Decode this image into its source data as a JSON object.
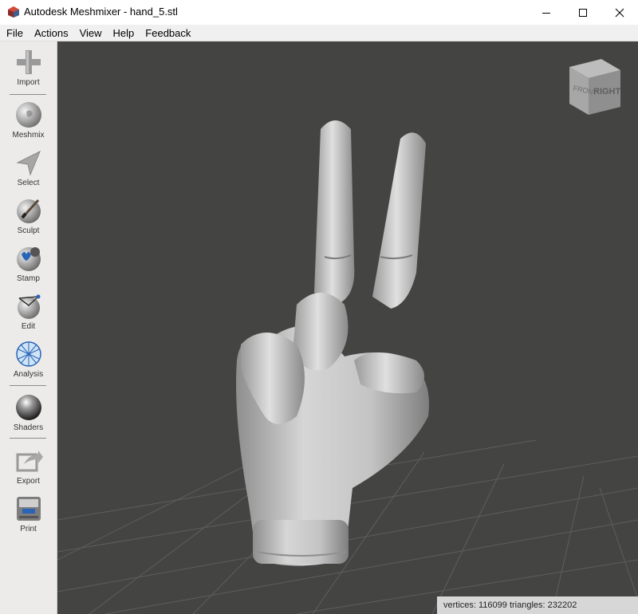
{
  "window": {
    "title": "Autodesk Meshmixer - hand_5.stl",
    "controls": [
      "minimize",
      "maximize",
      "close"
    ]
  },
  "menu": [
    "File",
    "Actions",
    "View",
    "Help",
    "Feedback"
  ],
  "tools": [
    {
      "label": "Import",
      "icon": "plus-icon"
    },
    {
      "label": "Meshmix",
      "icon": "meshmix-bunny-icon"
    },
    {
      "label": "Select",
      "icon": "select-arrow-icon"
    },
    {
      "label": "Sculpt",
      "icon": "sculpt-brush-icon"
    },
    {
      "label": "Stamp",
      "icon": "stamp-icon"
    },
    {
      "label": "Edit",
      "icon": "edit-sphere-icon"
    },
    {
      "label": "Analysis",
      "icon": "analysis-mesh-icon"
    },
    {
      "label": "Shaders",
      "icon": "shader-sphere-icon"
    },
    {
      "label": "Export",
      "icon": "export-icon"
    },
    {
      "label": "Print",
      "icon": "printer-icon"
    }
  ],
  "viewcube": {
    "front": "FRONT",
    "right": "RIGHT"
  },
  "status": "vertices: 116099 triangles: 232202"
}
